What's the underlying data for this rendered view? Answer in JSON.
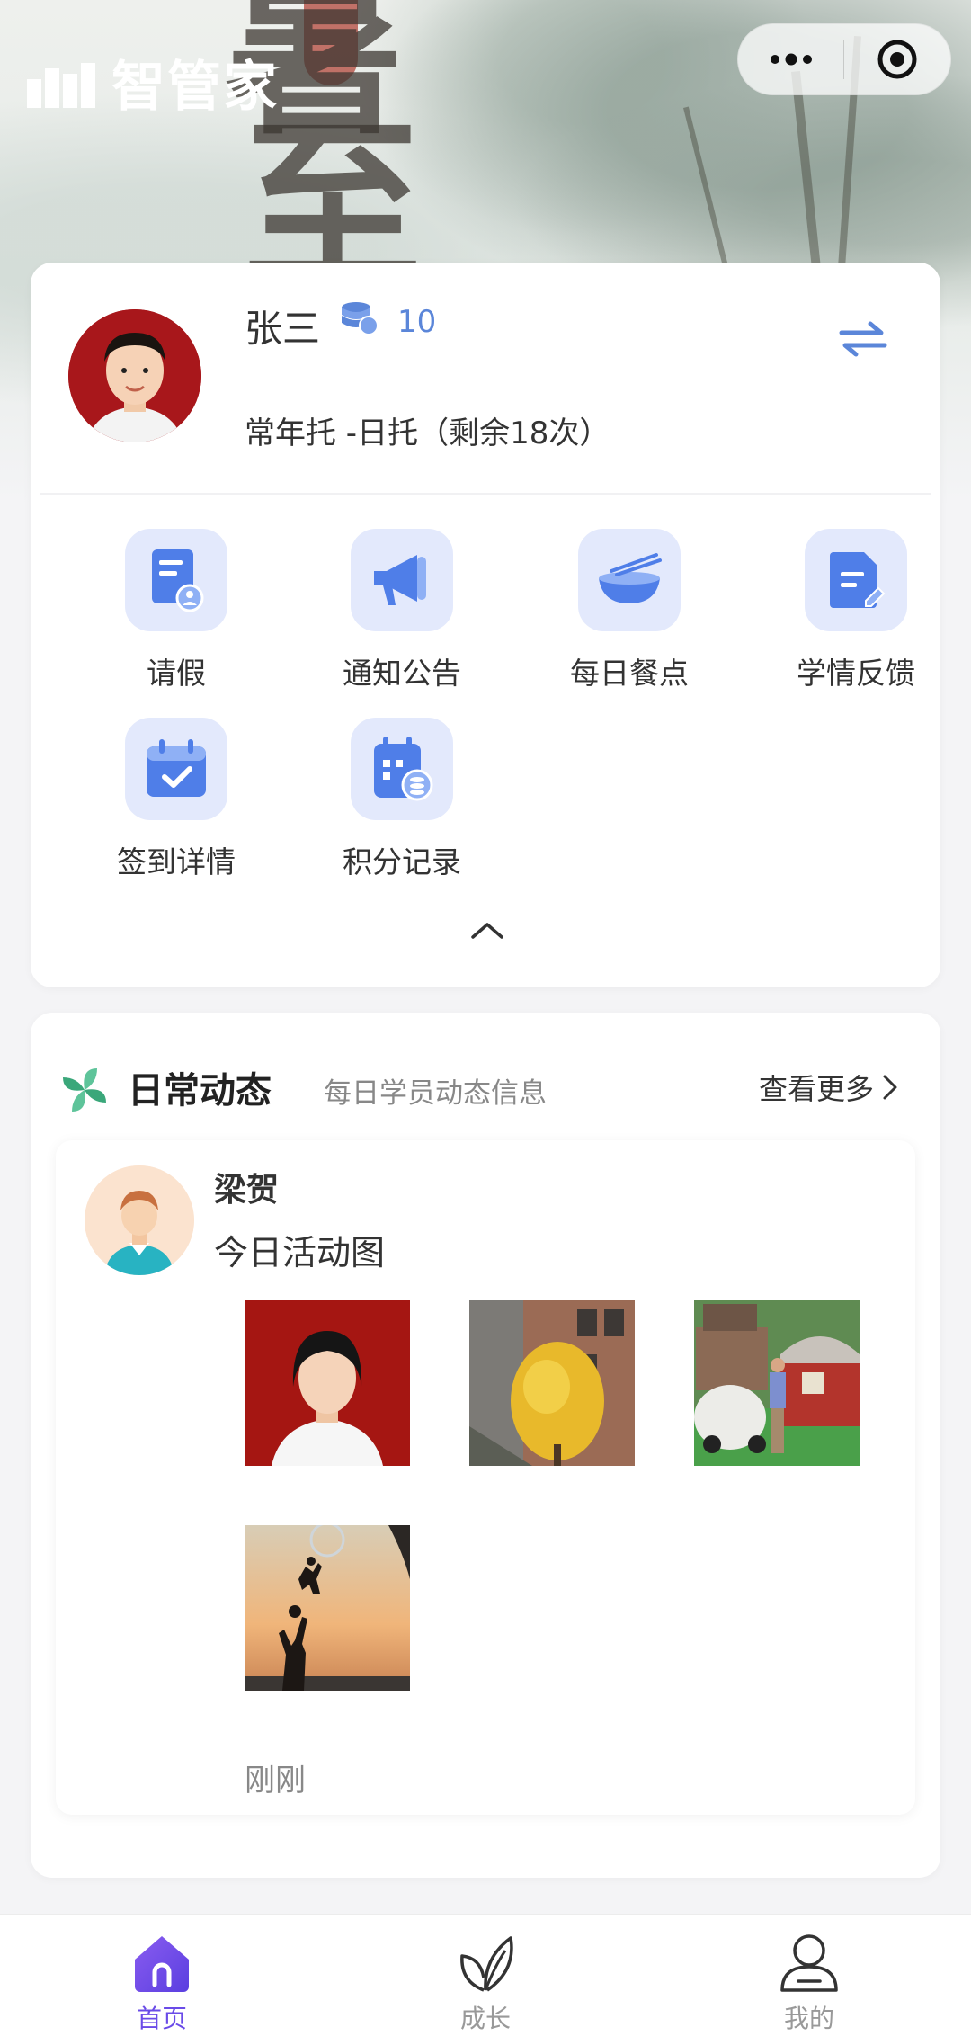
{
  "header": {
    "app_title": "智管家",
    "banner_art_text": [
      "暑",
      "至"
    ],
    "more_icon": "more-dots-icon",
    "close_icon": "target-circle-icon"
  },
  "profile": {
    "name": "张三",
    "points": "10",
    "plan": "常年托 -日托（剩余18次）",
    "coin_icon": "coin-stack-icon",
    "switch_icon": "swap-arrows-icon"
  },
  "menu": {
    "items": [
      {
        "label": "请假",
        "icon": "leave-doc-icon"
      },
      {
        "label": "通知公告",
        "icon": "megaphone-icon"
      },
      {
        "label": "每日餐点",
        "icon": "bowl-icon"
      },
      {
        "label": "学情反馈",
        "icon": "feedback-doc-icon"
      },
      {
        "label": "签到详情",
        "icon": "calendar-check-icon"
      },
      {
        "label": "积分记录",
        "icon": "calendar-coin-icon"
      }
    ],
    "collapse_icon": "chevron-up-icon"
  },
  "daily": {
    "title": "日常动态",
    "subtitle": "每日学员动态信息",
    "more": "查看更多",
    "post": {
      "name": "梁贺",
      "text": "今日活动图",
      "time": "刚刚",
      "photo_count": 4
    }
  },
  "tabbar": {
    "tabs": [
      {
        "label": "首页",
        "icon": "home-icon",
        "active": true
      },
      {
        "label": "成长",
        "icon": "leaf-icon",
        "active": false
      },
      {
        "label": "我的",
        "icon": "user-icon",
        "active": false
      }
    ]
  },
  "colors": {
    "accent": "#5b86d9",
    "tab_active": "#6a4be8",
    "icon_bg": "#e3e9fc",
    "icon_fg": "#4f7ee8"
  }
}
